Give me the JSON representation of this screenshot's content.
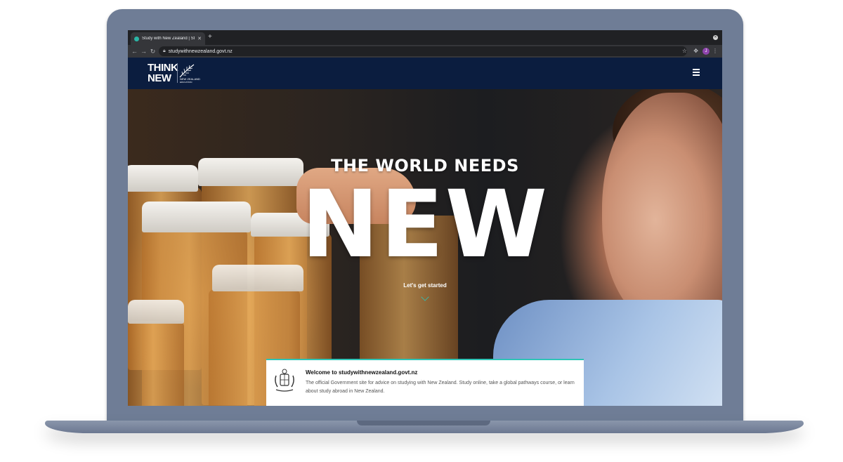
{
  "browser": {
    "tab_title": "Study with New Zealand | Stu",
    "url": "studywithnewzealand.govt.nz",
    "profile_initial": "J"
  },
  "site": {
    "logo_line1": "THINK",
    "logo_line2": "NEW",
    "logo_sub1": "NEW ZEALAND",
    "logo_sub2": "EDUCATION"
  },
  "hero": {
    "kicker": "THE WORLD NEEDS",
    "headline": "NEW",
    "cta": "Let's get started"
  },
  "banner": {
    "title": "Welcome to studywithnewzealand.govt.nz",
    "text": "The official Government site for advice on studying with New Zealand. Study online, take a global pathways course, or learn about study abroad in New Zealand."
  },
  "colors": {
    "header_bg": "#0b1d3f",
    "accent": "#2ec4b6",
    "laptop": "#6f7d96"
  }
}
